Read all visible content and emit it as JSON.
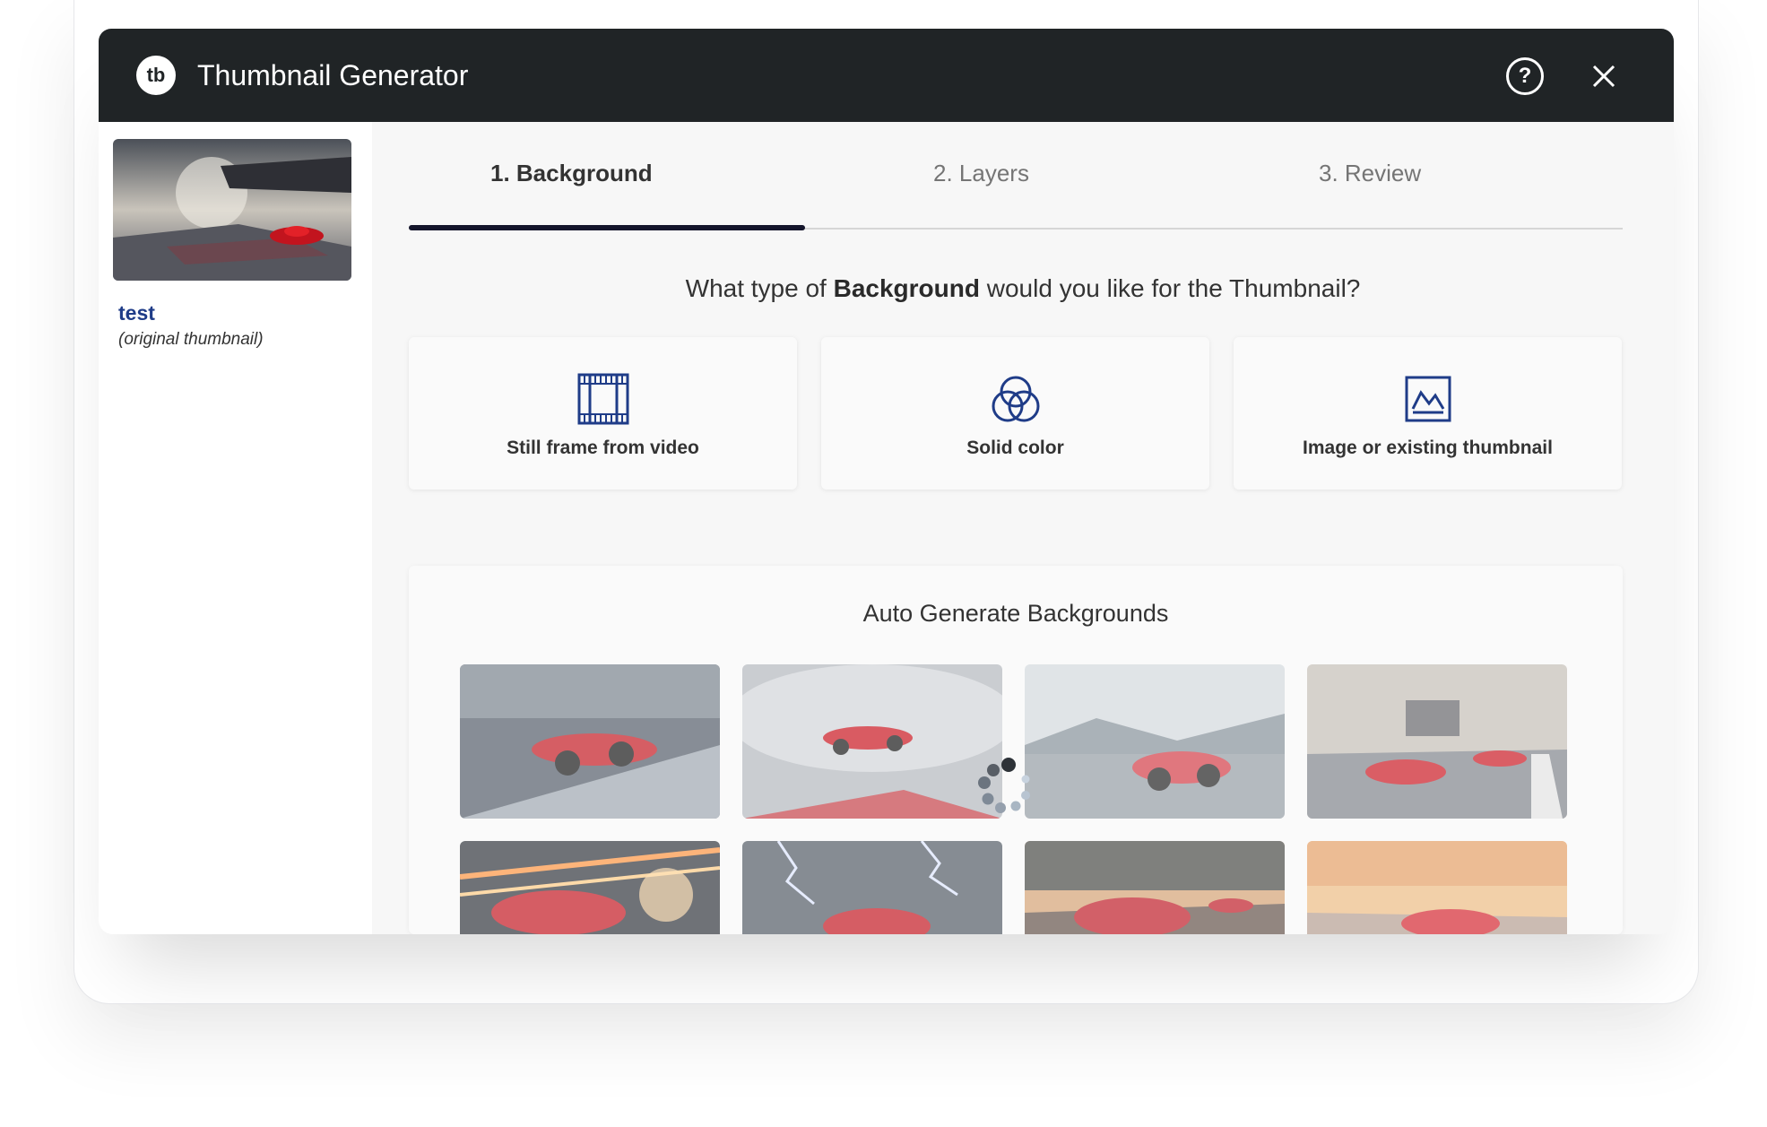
{
  "header": {
    "logo_text": "tb",
    "title": "Thumbnail Generator",
    "help_label": "?"
  },
  "sidebar": {
    "video_name": "test",
    "video_caption": "(original thumbnail)"
  },
  "tabs": [
    {
      "label": "1. Background",
      "active": true
    },
    {
      "label": "2. Layers",
      "active": false
    },
    {
      "label": "3. Review",
      "active": false
    }
  ],
  "question": {
    "prefix": "What type of",
    "emphasis": "Background",
    "suffix": "would you like for the Thumbnail?"
  },
  "options": [
    {
      "label": "Still frame from video",
      "icon": "film-icon"
    },
    {
      "label": "Solid color",
      "icon": "color-circles-icon"
    },
    {
      "label": "Image or existing thumbnail",
      "icon": "image-icon"
    }
  ],
  "auto_generate": {
    "title": "Auto Generate Backgrounds",
    "image_count": 8
  },
  "colors": {
    "header_bg": "#202426",
    "accent_blue": "#1f3c88",
    "tab_indicator": "#14152b"
  }
}
